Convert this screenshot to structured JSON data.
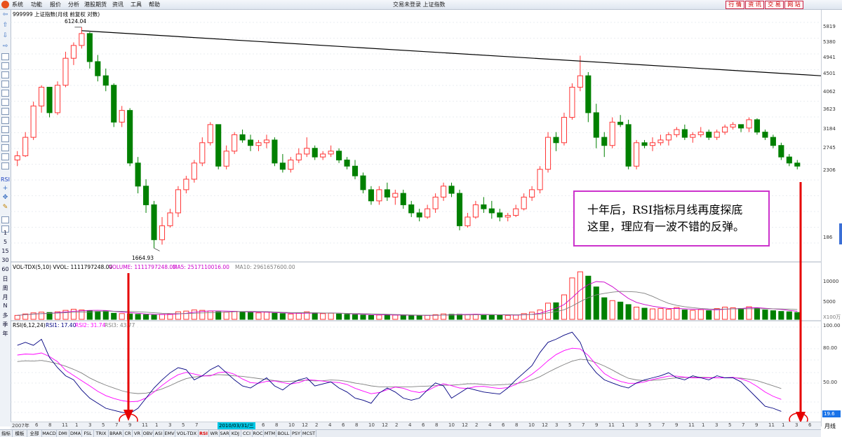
{
  "menubar": {
    "items": [
      "系统",
      "功能",
      "报价",
      "分析",
      "港股期货",
      "资讯",
      "工具",
      "帮助"
    ],
    "title": "交易未登录   上证指数",
    "buttons": [
      "行 情",
      "资 讯",
      "交 易",
      "网 站"
    ]
  },
  "toolbar": {
    "labels": [
      "1",
      "5",
      "15",
      "30",
      "60",
      "日",
      "周",
      "月",
      "N",
      "多",
      "季",
      "年"
    ]
  },
  "price_panel": {
    "header": "999999 上证指数(月线 前复权 对数)",
    "high_label": "6124.04",
    "low_label": "1664.93",
    "yticks": [
      "5819",
      "5380",
      "4941",
      "4501",
      "4062",
      "3623",
      "3184",
      "2745",
      "2306",
      "186"
    ]
  },
  "vol_panel": {
    "header": "VOL-TDX(5,10)  VVOL: 1111797248.00",
    "volume": "VOLUME: 1111797248.00",
    "ma5": "MA5: 2517110016.00",
    "ma10": "MA10: 2961657600.00",
    "yticks": [
      "10000",
      "5000"
    ],
    "unit": "X100万",
    "colors": {
      "volume": "#cc00cc",
      "ma5": "#cc00cc",
      "ma10": "#808080"
    }
  },
  "rsi_panel": {
    "header": "RSI(6,12,24)",
    "rsi1": "RSI1: 17.40",
    "rsi2": "RSI2: 31.74",
    "rsi3": "RSI3: 43.77",
    "yticks": [
      "100.00",
      "80.00",
      "50.00"
    ],
    "badge": "19.6"
  },
  "date_axis": {
    "highlight": "2010/03/31/三",
    "labels": [
      "2007年",
      "6",
      "8",
      "11",
      "1",
      "3",
      "5",
      "7",
      "9",
      "11",
      "1",
      "3",
      "5",
      "7",
      "9",
      "12",
      "2",
      "4",
      "6",
      "8",
      "10",
      "12",
      "2",
      "4",
      "6",
      "8",
      "10",
      "12",
      "2",
      "4",
      "6",
      "8",
      "10",
      "12",
      "2",
      "4",
      "6",
      "8",
      "10",
      "12",
      "3",
      "5",
      "7",
      "9",
      "11",
      "1",
      "3",
      "5",
      "7",
      "9",
      "11",
      "1",
      "3",
      "5",
      "7",
      "9",
      "11",
      "1",
      "3",
      "6"
    ]
  },
  "annotation": {
    "line1": "十年后，RSI指标月线再度探底",
    "line2": "这里，理应有一波不错的反弹。"
  },
  "period_label": "月线",
  "bottom_tabs": [
    "指标",
    "模板",
    "全部",
    "MACD",
    "DMI",
    "DMA",
    "FSL",
    "TRIX",
    "BRAR",
    "CR",
    "VR",
    "OBV",
    "ASI",
    "EMV",
    "VOL-TDX",
    "RSI",
    "WR",
    "SAR",
    "KDJ",
    "CCI",
    "ROC",
    "MTM",
    "BOLL",
    "PSY",
    "MCST"
  ],
  "colors": {
    "up": "#ff3333",
    "down": "#008000",
    "trend": "#000000",
    "rsi1": "#000080",
    "rsi2": "#ff00ff",
    "rsi3": "#808080",
    "arrow": "#e60000"
  },
  "chart_data": {
    "type": "candlestick",
    "scale": "log",
    "period": "monthly",
    "ylim": [
      1600,
      6300
    ],
    "candles": [
      [
        2800,
        2950,
        2700,
        2870
      ],
      [
        2870,
        3300,
        2850,
        3200
      ],
      [
        3200,
        3950,
        3150,
        3850
      ],
      [
        3850,
        4350,
        3700,
        4300
      ],
      [
        4300,
        4150,
        3600,
        3700
      ],
      [
        3700,
        4450,
        3650,
        4350
      ],
      [
        4350,
        5300,
        4300,
        5100
      ],
      [
        5100,
        5600,
        4900,
        5500
      ],
      [
        5500,
        6124.04,
        5400,
        5900
      ],
      [
        5900,
        5950,
        4800,
        5000
      ],
      [
        5000,
        5200,
        4450,
        4600
      ],
      [
        4600,
        4800,
        4200,
        4350
      ],
      [
        4350,
        4400,
        3400,
        3500
      ],
      [
        3500,
        3850,
        3400,
        3750
      ],
      [
        3750,
        3800,
        2700,
        2750
      ],
      [
        2750,
        2850,
        2300,
        2400
      ],
      [
        2400,
        2500,
        2050,
        2150
      ],
      [
        2150,
        2200,
        1664.93,
        1750
      ],
      [
        1750,
        2000,
        1700,
        1900
      ],
      [
        1900,
        2100,
        1880,
        2050
      ],
      [
        2050,
        2400,
        2000,
        2350
      ],
      [
        2350,
        2550,
        2300,
        2500
      ],
      [
        2500,
        2800,
        2450,
        2750
      ],
      [
        2750,
        3200,
        2700,
        3100
      ],
      [
        3100,
        3500,
        3050,
        3450
      ],
      [
        3450,
        3450,
        2650,
        2700
      ],
      [
        2700,
        3050,
        2650,
        2950
      ],
      [
        2950,
        3300,
        2900,
        3250
      ],
      [
        3250,
        3350,
        3100,
        3150
      ],
      [
        3150,
        3250,
        2950,
        3050
      ],
      [
        3050,
        3150,
        2950,
        3100
      ],
      [
        3100,
        3250,
        3000,
        3150
      ],
      [
        3150,
        3200,
        2700,
        2750
      ],
      [
        2750,
        2900,
        2600,
        2650
      ],
      [
        2650,
        2850,
        2600,
        2800
      ],
      [
        2800,
        3000,
        2750,
        2900
      ],
      [
        2900,
        3200,
        2850,
        3000
      ],
      [
        3000,
        3050,
        2800,
        2850
      ],
      [
        2850,
        2950,
        2800,
        2900
      ],
      [
        2900,
        3050,
        2850,
        2950
      ],
      [
        2950,
        3000,
        2750,
        2800
      ],
      [
        2800,
        2850,
        2650,
        2700
      ],
      [
        2700,
        2800,
        2500,
        2550
      ],
      [
        2550,
        2600,
        2300,
        2350
      ],
      [
        2350,
        2400,
        2150,
        2200
      ],
      [
        2200,
        2400,
        2150,
        2350
      ],
      [
        2350,
        2450,
        2200,
        2250
      ],
      [
        2250,
        2350,
        2150,
        2300
      ],
      [
        2300,
        2350,
        2100,
        2150
      ],
      [
        2150,
        2200,
        2000,
        2050
      ],
      [
        2050,
        2100,
        1950,
        2000
      ],
      [
        2000,
        2150,
        1980,
        2100
      ],
      [
        2100,
        2300,
        2050,
        2250
      ],
      [
        2250,
        2450,
        2200,
        2400
      ],
      [
        2400,
        2450,
        2250,
        2300
      ],
      [
        2300,
        2350,
        1850,
        1900
      ],
      [
        1900,
        2050,
        1880,
        2000
      ],
      [
        2000,
        2200,
        1980,
        2150
      ],
      [
        2150,
        2250,
        2050,
        2100
      ],
      [
        2100,
        2200,
        1980,
        2050
      ],
      [
        2050,
        2100,
        1950,
        2000
      ],
      [
        2000,
        2050,
        1950,
        2020
      ],
      [
        2020,
        2150,
        2000,
        2100
      ],
      [
        2100,
        2300,
        2080,
        2250
      ],
      [
        2250,
        2400,
        2200,
        2350
      ],
      [
        2350,
        2700,
        2300,
        2650
      ],
      [
        2650,
        3300,
        2600,
        3200
      ],
      [
        3200,
        3300,
        2950,
        3100
      ],
      [
        3100,
        3700,
        3050,
        3600
      ],
      [
        3600,
        4400,
        3550,
        4300
      ],
      [
        4300,
        5178,
        4200,
        4600
      ],
      [
        4600,
        4700,
        3500,
        3700
      ],
      [
        3700,
        3900,
        3000,
        3200
      ],
      [
        3200,
        3300,
        2850,
        3050
      ],
      [
        3050,
        3600,
        3000,
        3500
      ],
      [
        3500,
        3650,
        3400,
        3450
      ],
      [
        3450,
        3550,
        2650,
        2700
      ],
      [
        2700,
        3150,
        2650,
        3100
      ],
      [
        3100,
        3150,
        3000,
        3050
      ],
      [
        3050,
        3200,
        2950,
        3100
      ],
      [
        3100,
        3250,
        3050,
        3150
      ],
      [
        3150,
        3300,
        3050,
        3250
      ],
      [
        3250,
        3400,
        3200,
        3350
      ],
      [
        3350,
        3450,
        3150,
        3200
      ],
      [
        3200,
        3300,
        3100,
        3250
      ],
      [
        3250,
        3400,
        3200,
        3300
      ],
      [
        3300,
        3350,
        3150,
        3200
      ],
      [
        3200,
        3350,
        3150,
        3300
      ],
      [
        3300,
        3450,
        3250,
        3400
      ],
      [
        3400,
        3500,
        3350,
        3450
      ],
      [
        3450,
        3450,
        3300,
        3380
      ],
      [
        3380,
        3600,
        3300,
        3550
      ],
      [
        3550,
        3580,
        3250,
        3300
      ],
      [
        3300,
        3350,
        3150,
        3200
      ],
      [
        3200,
        3250,
        3000,
        3050
      ],
      [
        3050,
        3100,
        2800,
        2850
      ],
      [
        2850,
        2900,
        2700,
        2750
      ],
      [
        2750,
        2800,
        2650,
        2700
      ]
    ],
    "volume_bars": [
      1100,
      1500,
      1800,
      2000,
      1900,
      2100,
      2500,
      2800,
      2600,
      2400,
      2200,
      2300,
      1700,
      1600,
      1500,
      1400,
      1300,
      1200,
      1400,
      1500,
      2100,
      2300,
      2600,
      2500,
      2300,
      2100,
      2000,
      2200,
      2100,
      1900,
      1800,
      2000,
      1700,
      1600,
      1500,
      1700,
      2100,
      1800,
      1600,
      1700,
      1500,
      1400,
      1300,
      1200,
      1100,
      1200,
      1300,
      1200,
      1100,
      1000,
      1000,
      1100,
      1300,
      1500,
      1400,
      1400,
      1300,
      1400,
      1300,
      1200,
      1100,
      1100,
      1200,
      1600,
      2000,
      2600,
      4500,
      4600,
      6800,
      11500,
      13200,
      12000,
      9000,
      6000,
      5200,
      4800,
      4100,
      3400,
      3100,
      2900,
      3000,
      2800,
      3300,
      2600,
      2500,
      2700,
      2400,
      3000,
      3400,
      3200,
      3000,
      3500,
      3100,
      2600,
      2400,
      2200,
      2100,
      1900
    ],
    "rsi1": [
      82,
      85,
      82,
      88,
      70,
      60,
      52,
      48,
      38,
      30,
      25,
      20,
      18,
      16,
      15,
      20,
      30,
      40,
      48,
      55,
      60,
      58,
      48,
      52,
      58,
      62,
      55,
      48,
      42,
      40,
      45,
      50,
      42,
      38,
      44,
      48,
      50,
      42,
      44,
      46,
      40,
      36,
      30,
      28,
      25,
      35,
      40,
      36,
      30,
      28,
      30,
      38,
      45,
      42,
      30,
      35,
      40,
      38,
      36,
      35,
      34,
      40,
      48,
      55,
      62,
      75,
      85,
      88,
      92,
      95,
      85,
      65,
      55,
      48,
      45,
      42,
      40,
      45,
      48,
      50,
      52,
      55,
      50,
      48,
      52,
      50,
      48,
      52,
      50,
      50,
      46,
      38,
      30,
      22,
      20,
      17
    ]
  }
}
